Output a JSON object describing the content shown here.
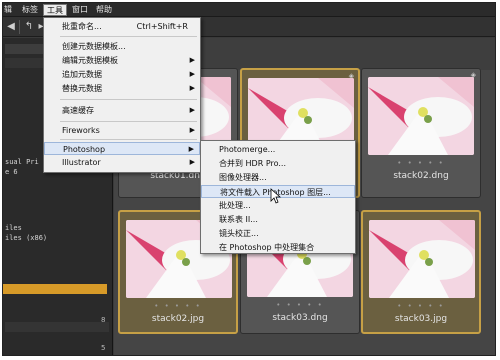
{
  "menubar": {
    "items": [
      {
        "label": "辑",
        "active": false
      },
      {
        "label": "标签",
        "active": false
      },
      {
        "label": "工具",
        "active": true
      },
      {
        "label": "窗口",
        "active": false
      },
      {
        "label": "帮助",
        "active": false
      }
    ]
  },
  "tools_menu": {
    "items": [
      {
        "label": "批重命名...",
        "shortcut": "Ctrl+Shift+R"
      },
      {
        "label": "创建元数据模板..."
      },
      {
        "label": "编辑元数据模板"
      },
      {
        "label": "追加元数据"
      },
      {
        "label": "替换元数据"
      },
      {
        "label": "高速缓存"
      },
      {
        "label": "Fireworks"
      },
      {
        "label": "Photoshop",
        "highlighted": true
      },
      {
        "label": "Illustrator"
      }
    ]
  },
  "photoshop_submenu": {
    "items": [
      {
        "label": "Photomerge..."
      },
      {
        "label": "合并到 HDR Pro..."
      },
      {
        "label": "图像处理器..."
      },
      {
        "label": "将文件载入 Photoshop 图层...",
        "highlighted": true
      },
      {
        "label": "批处理..."
      },
      {
        "label": "联系表 II..."
      },
      {
        "label": "镜头校正..."
      },
      {
        "label": "在 Photoshop 中处理集合"
      }
    ]
  },
  "left_panel": {
    "lines": [
      "sual Pri",
      "e 6",
      "iles",
      "iles (x86)"
    ],
    "numbers": [
      "8",
      "5"
    ]
  },
  "thumbnails": [
    {
      "caption": "stack01.dng",
      "selected": false
    },
    {
      "caption": "stack02.dng",
      "selected": false
    },
    {
      "caption": "stack02.jpg",
      "selected": true
    },
    {
      "caption": "stack03.dng",
      "selected": false
    },
    {
      "caption": "stack03.jpg",
      "selected": true
    }
  ],
  "thumb_dots": "• • • • •",
  "colors": {
    "accent": "#c6a046",
    "menu_bg": "#f0f0f0",
    "menu_highlight": "#dde7f6",
    "panel_orange": "#d79a28"
  },
  "icons": {
    "back": "back-arrow-icon",
    "forward": "forward-arrow-icon",
    "up": "up-arrow-icon",
    "submenu": "chevron-right-icon",
    "badge": "stack-badge-icon"
  }
}
